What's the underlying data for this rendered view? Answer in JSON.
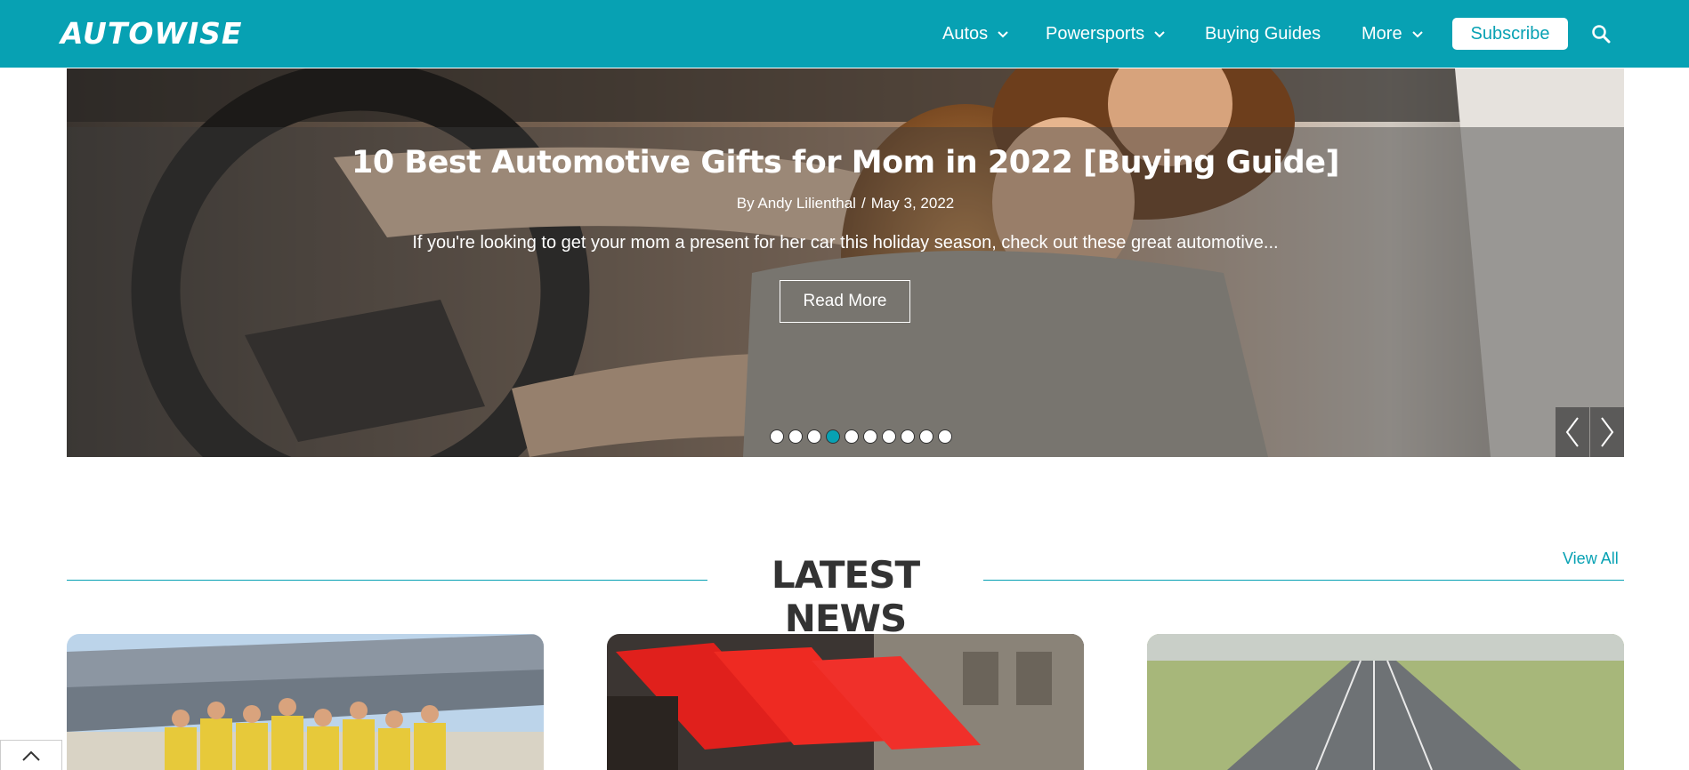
{
  "header": {
    "logo_text": "AutoWise",
    "nav": [
      {
        "label": "Autos",
        "has_dropdown": true
      },
      {
        "label": "Powersports",
        "has_dropdown": true
      },
      {
        "label": "Buying Guides",
        "has_dropdown": false
      },
      {
        "label": "More",
        "has_dropdown": true
      }
    ],
    "subscribe_label": "Subscribe",
    "search_icon": "search-icon"
  },
  "hero": {
    "title": "10 Best Automotive Gifts for Mom in 2022 [Buying Guide]",
    "author": "By Andy Lilienthal",
    "separator": "/",
    "date": "May 3, 2022",
    "excerpt": "If you're looking to get your mom a present for her car this holiday season, check out these great automotive...",
    "read_more_label": "Read More",
    "slide_count": 10,
    "active_slide": 4,
    "prev_icon": "chevron-left-icon",
    "next_icon": "chevron-right-icon"
  },
  "latest_news": {
    "title": "LATEST NEWS",
    "view_all_label": "View All"
  },
  "colors": {
    "brand": "#07a1b3",
    "heading": "#333333",
    "white": "#ffffff"
  },
  "back_to_top_icon": "chevron-up-icon"
}
